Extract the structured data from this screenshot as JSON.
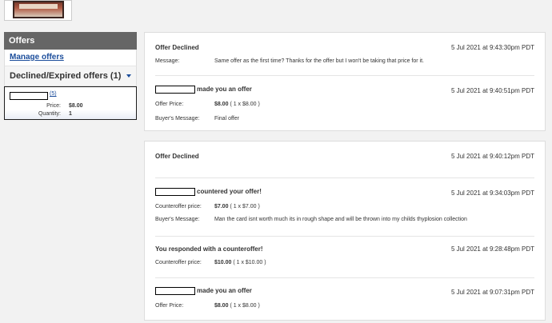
{
  "sidebar": {
    "header": "Offers",
    "manage_link": "Manage offers",
    "section_title": "Declined/Expired offers (1)",
    "item": {
      "count": "(5)",
      "price_label": "Price:",
      "price_value": "$8.00",
      "quantity_label": "Quantity:",
      "quantity_value": "1"
    }
  },
  "panel1": {
    "e1": {
      "title": "Offer Declined",
      "date": "5 Jul 2021 at 9:43:30pm PDT",
      "message_label": "Message:",
      "message_value": "Same offer as the first time? Thanks for the offer but I won't be taking that price for it."
    },
    "e2": {
      "title": "made you an offer",
      "date": "5 Jul 2021 at 9:40:51pm PDT",
      "price_label": "Offer Price:",
      "price_value": "$8.00",
      "price_detail": "( 1 x $8.00 )",
      "msg_label": "Buyer's Message:",
      "msg_value": "Final offer"
    }
  },
  "panel2": {
    "e1": {
      "title": "Offer Declined",
      "date": "5 Jul 2021 at 9:40:12pm PDT"
    },
    "e2": {
      "title": "countered your offer!",
      "date": "5 Jul 2021 at 9:34:03pm PDT",
      "price_label": "Counteroffer price:",
      "price_value": "$7.00",
      "price_detail": "( 1 x $7.00 )",
      "msg_label": "Buyer's Message:",
      "msg_value": "Man the card isnt worth much its in rough shape and will be thrown into my childs thyplosion collection"
    },
    "e3": {
      "title": "You responded with a counteroffer!",
      "date": "5 Jul 2021 at 9:28:48pm PDT",
      "price_label": "Counteroffer price:",
      "price_value": "$10.00",
      "price_detail": "( 1 x $10.00 )"
    },
    "e4": {
      "title": "made you an offer",
      "date": "5 Jul 2021 at 9:07:31pm PDT",
      "price_label": "Offer Price:",
      "price_value": "$8.00",
      "price_detail": "( 1 x $8.00 )"
    }
  }
}
